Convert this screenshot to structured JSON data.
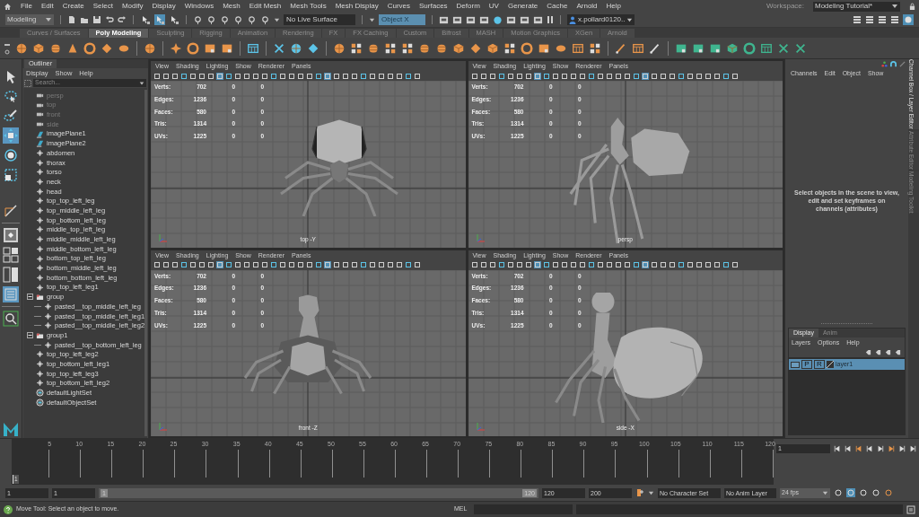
{
  "menubar": {
    "items": [
      "File",
      "Edit",
      "Create",
      "Select",
      "Modify",
      "Display",
      "Windows",
      "Mesh",
      "Edit Mesh",
      "Mesh Tools",
      "Mesh Display",
      "Curves",
      "Surfaces",
      "Deform",
      "UV",
      "Generate",
      "Cache",
      "Arnold",
      "Help"
    ],
    "workspace_label": "Workspace:",
    "workspace": "Modeling Tutorial*"
  },
  "status_line": {
    "menu_set": "Modeling",
    "live_surface": "No Live Surface",
    "symmetry": "Object X",
    "user": "x.pollard0120.."
  },
  "shelf_tabs": [
    {
      "label": "Curves / Surfaces",
      "selected": false
    },
    {
      "label": "Poly Modeling",
      "selected": true
    },
    {
      "label": "Sculpting",
      "selected": false
    },
    {
      "label": "Rigging",
      "selected": false
    },
    {
      "label": "Animation",
      "selected": false
    },
    {
      "label": "Rendering",
      "selected": false
    },
    {
      "label": "FX",
      "selected": false
    },
    {
      "label": "FX Caching",
      "selected": false
    },
    {
      "label": "Custom",
      "selected": false
    },
    {
      "label": "Bifrost",
      "selected": false
    },
    {
      "label": "MASH",
      "selected": false
    },
    {
      "label": "Motion Graphics",
      "selected": false
    },
    {
      "label": "XGen",
      "selected": false
    },
    {
      "label": "Arnold",
      "selected": false
    }
  ],
  "toolbox": [
    {
      "selected": false
    },
    {
      "selected": false
    },
    {
      "selected": false
    },
    {
      "selected": true
    },
    {
      "selected": false
    },
    {
      "selected": false
    }
  ],
  "outliner": {
    "title": "Outliner",
    "menu": [
      "Display",
      "Show",
      "Help"
    ],
    "search_placeholder": "Search...",
    "items": [
      {
        "label": "persp",
        "kind": "camera",
        "hidden": true
      },
      {
        "label": "top",
        "kind": "camera",
        "hidden": true
      },
      {
        "label": "front",
        "kind": "camera",
        "hidden": true
      },
      {
        "label": "side",
        "kind": "camera",
        "hidden": true
      },
      {
        "label": "imagePlane1",
        "kind": "imageplane",
        "hidden": false
      },
      {
        "label": "imagePlane2",
        "kind": "imageplane",
        "hidden": false
      },
      {
        "label": "abdomen",
        "kind": "mesh",
        "hidden": false
      },
      {
        "label": "thorax",
        "kind": "mesh",
        "hidden": false
      },
      {
        "label": "torso",
        "kind": "mesh",
        "hidden": false
      },
      {
        "label": "neck",
        "kind": "mesh",
        "hidden": false
      },
      {
        "label": "head",
        "kind": "mesh",
        "hidden": false
      },
      {
        "label": "top_top_left_leg",
        "kind": "mesh",
        "hidden": false
      },
      {
        "label": "top_middle_left_leg",
        "kind": "mesh",
        "hidden": false
      },
      {
        "label": "top_bottom_left_leg",
        "kind": "mesh",
        "hidden": false
      },
      {
        "label": "middle_top_left_leg",
        "kind": "mesh",
        "hidden": false
      },
      {
        "label": "middle_middle_left_leg",
        "kind": "mesh",
        "hidden": false
      },
      {
        "label": "middle_bottom_left_leg",
        "kind": "mesh",
        "hidden": false
      },
      {
        "label": "bottom_top_left_leg",
        "kind": "mesh",
        "hidden": false
      },
      {
        "label": "bottom_middle_left_leg",
        "kind": "mesh",
        "hidden": false
      },
      {
        "label": "bottom_bottom_left_leg",
        "kind": "mesh",
        "hidden": false
      },
      {
        "label": "top_top_left_leg1",
        "kind": "mesh",
        "hidden": false
      },
      {
        "label": "group",
        "kind": "group",
        "hidden": false,
        "expanded": true,
        "children": [
          {
            "label": "pasted__top_middle_left_leg",
            "kind": "mesh",
            "hidden": false
          },
          {
            "label": "pasted__top_middle_left_leg1",
            "kind": "mesh",
            "hidden": false
          },
          {
            "label": "pasted__top_middle_left_leg2",
            "kind": "mesh",
            "hidden": false
          }
        ]
      },
      {
        "label": "group1",
        "kind": "group",
        "hidden": false,
        "expanded": true,
        "children": [
          {
            "label": "pasted__top_bottom_left_leg",
            "kind": "mesh",
            "hidden": false
          }
        ]
      },
      {
        "label": "top_top_left_leg2",
        "kind": "mesh",
        "hidden": false
      },
      {
        "label": "top_bottom_left_leg1",
        "kind": "mesh",
        "hidden": false
      },
      {
        "label": "top_top_left_leg3",
        "kind": "mesh",
        "hidden": false
      },
      {
        "label": "top_bottom_left_leg2",
        "kind": "mesh",
        "hidden": false
      },
      {
        "label": "defaultLightSet",
        "kind": "set",
        "hidden": false
      },
      {
        "label": "defaultObjectSet",
        "kind": "set",
        "hidden": false
      }
    ]
  },
  "viewports": [
    {
      "menu": [
        "View",
        "Shading",
        "Lighting",
        "Show",
        "Renderer",
        "Panels"
      ],
      "camera": "top -Y",
      "stats": [
        {
          "label": "Verts:",
          "values": [
            "702",
            "0",
            "0"
          ]
        },
        {
          "label": "Edges:",
          "values": [
            "1236",
            "0",
            "0"
          ]
        },
        {
          "label": "Faces:",
          "values": [
            "580",
            "0",
            "0"
          ]
        },
        {
          "label": "Tris:",
          "values": [
            "1314",
            "0",
            "0"
          ]
        },
        {
          "label": "UVs:",
          "values": [
            "1225",
            "0",
            "0"
          ]
        }
      ]
    },
    {
      "menu": [
        "View",
        "Shading",
        "Lighting",
        "Show",
        "Renderer",
        "Panels"
      ],
      "camera": "persp",
      "stats": [
        {
          "label": "Verts:",
          "values": [
            "702",
            "0",
            "0"
          ]
        },
        {
          "label": "Edges:",
          "values": [
            "1236",
            "0",
            "0"
          ]
        },
        {
          "label": "Faces:",
          "values": [
            "580",
            "0",
            "0"
          ]
        },
        {
          "label": "Tris:",
          "values": [
            "1314",
            "0",
            "0"
          ]
        },
        {
          "label": "UVs:",
          "values": [
            "1225",
            "0",
            "0"
          ]
        }
      ]
    },
    {
      "menu": [
        "View",
        "Shading",
        "Lighting",
        "Show",
        "Renderer",
        "Panels"
      ],
      "camera": "front -Z",
      "stats": [
        {
          "label": "Verts:",
          "values": [
            "702",
            "0",
            "0"
          ]
        },
        {
          "label": "Edges:",
          "values": [
            "1236",
            "0",
            "0"
          ]
        },
        {
          "label": "Faces:",
          "values": [
            "580",
            "0",
            "0"
          ]
        },
        {
          "label": "Tris:",
          "values": [
            "1314",
            "0",
            "0"
          ]
        },
        {
          "label": "UVs:",
          "values": [
            "1225",
            "0",
            "0"
          ]
        }
      ]
    },
    {
      "menu": [
        "View",
        "Shading",
        "Lighting",
        "Show",
        "Renderer",
        "Panels"
      ],
      "camera": "side -X",
      "stats": [
        {
          "label": "Verts:",
          "values": [
            "702",
            "0",
            "0"
          ]
        },
        {
          "label": "Edges:",
          "values": [
            "1236",
            "0",
            "0"
          ]
        },
        {
          "label": "Faces:",
          "values": [
            "580",
            "0",
            "0"
          ]
        },
        {
          "label": "Tris:",
          "values": [
            "1314",
            "0",
            "0"
          ]
        },
        {
          "label": "UVs:",
          "values": [
            "1225",
            "0",
            "0"
          ]
        }
      ]
    }
  ],
  "channel_box": {
    "menu": [
      "Channels",
      "Edit",
      "Object",
      "Show"
    ],
    "message": "Select objects in the scene to view, edit and set keyframes on channels (attributes)"
  },
  "side_tabs": [
    {
      "label": "Channel Box / Layer Editor",
      "selected": true
    },
    {
      "label": "Attribute Editor",
      "selected": false
    },
    {
      "label": "Modeling Toolkit",
      "selected": false
    }
  ],
  "layer_editor": {
    "tabs": [
      {
        "label": "Display",
        "selected": true
      },
      {
        "label": "Anim",
        "selected": false
      }
    ],
    "menu": [
      "Layers",
      "Options",
      "Help"
    ],
    "layers": [
      {
        "name": "layer1",
        "playback": "P",
        "render": "R",
        "selected": true
      }
    ]
  },
  "timeline": {
    "ticks": [
      "5",
      "10",
      "15",
      "20",
      "25",
      "30",
      "35",
      "40",
      "45",
      "50",
      "55",
      "60",
      "65",
      "70",
      "75",
      "80",
      "85",
      "90",
      "95",
      "100",
      "105",
      "110",
      "115",
      "120"
    ],
    "current_marker": "1",
    "level": 0,
    "current_frame": "1"
  },
  "range": {
    "start": "1",
    "playback_start": "1",
    "slider_start": "1",
    "slider_end": "120",
    "level": 1,
    "playback_end": "120",
    "end": "200",
    "character_set": "No Character Set",
    "anim_layer": "No Anim Layer",
    "fps": "24 fps"
  },
  "help_line": {
    "message": "Move Tool: Select an object to move.",
    "mel_label": "MEL"
  }
}
